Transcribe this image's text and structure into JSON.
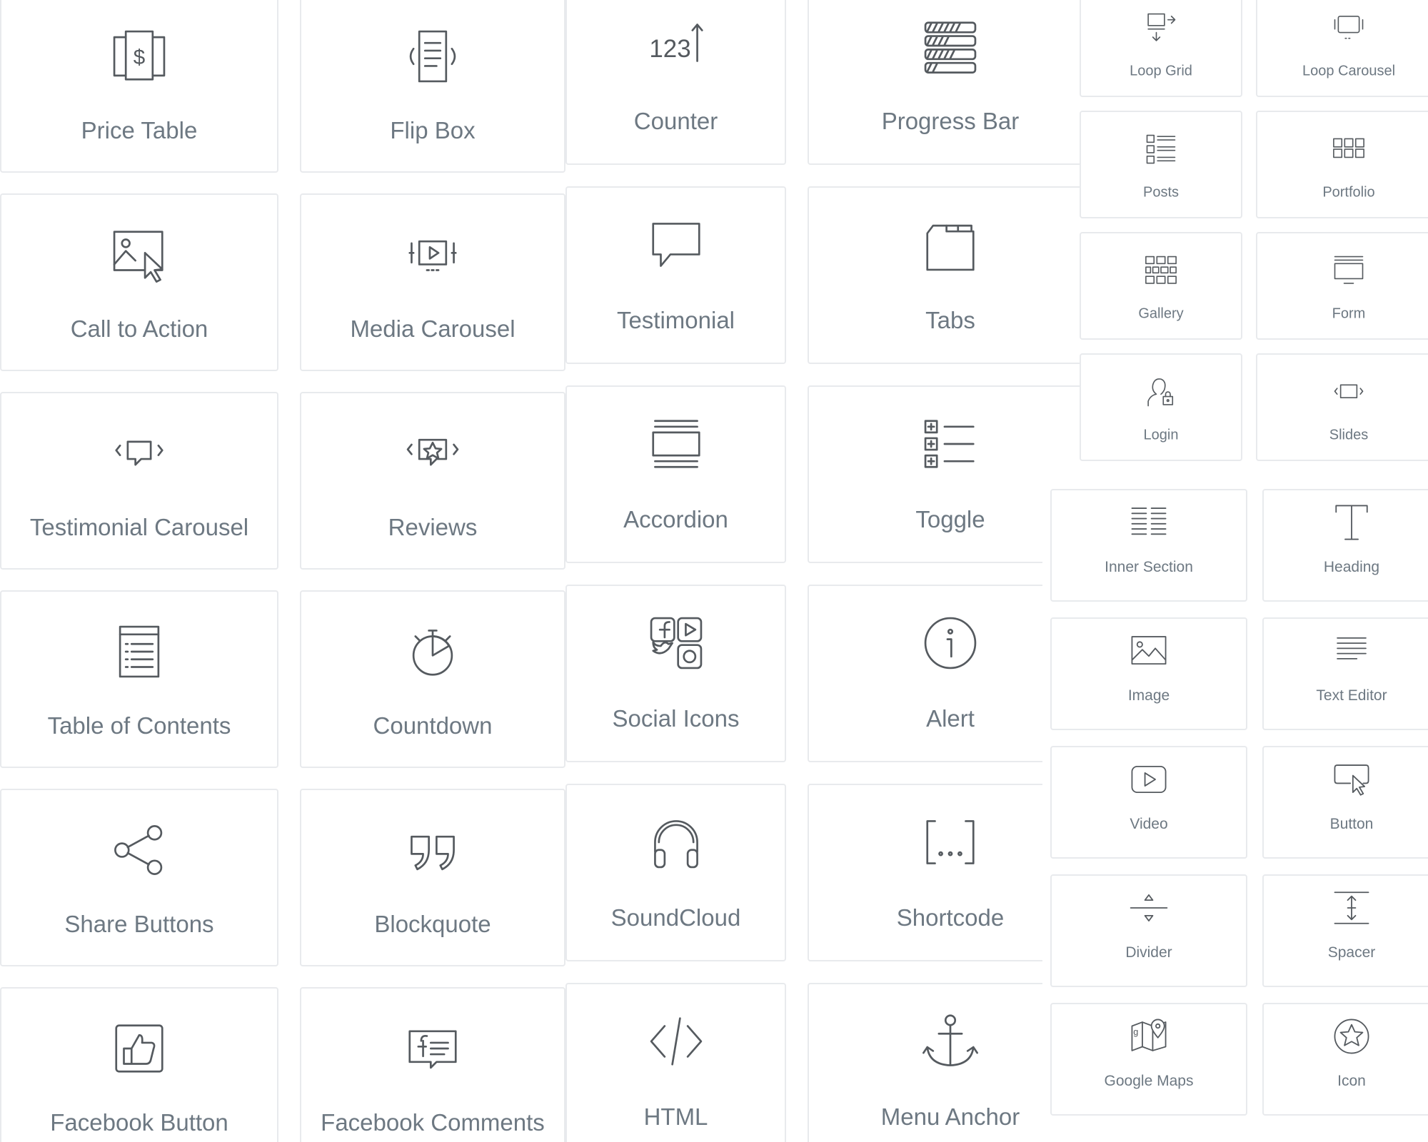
{
  "colors": {
    "text": "#6d7882",
    "icon": "#555a5f",
    "border": "#e8eaed",
    "background": "#ffffff"
  },
  "panels": [
    {
      "id": "pro-widgets-a",
      "widgets": [
        {
          "label": "Price Table",
          "icon": "price-table-icon"
        },
        {
          "label": "Flip Box",
          "icon": "flip-box-icon"
        },
        {
          "label": "Call to Action",
          "icon": "call-to-action-icon"
        },
        {
          "label": "Media Carousel",
          "icon": "media-carousel-icon"
        },
        {
          "label": "Testimonial Carousel",
          "icon": "testimonial-carousel-icon"
        },
        {
          "label": "Reviews",
          "icon": "reviews-icon"
        },
        {
          "label": "Table of Contents",
          "icon": "table-of-contents-icon"
        },
        {
          "label": "Countdown",
          "icon": "countdown-icon"
        },
        {
          "label": "Share Buttons",
          "icon": "share-icon"
        },
        {
          "label": "Blockquote",
          "icon": "blockquote-icon"
        },
        {
          "label": "Facebook Button",
          "icon": "facebook-like-icon"
        },
        {
          "label": "Facebook Comments",
          "icon": "facebook-comments-icon"
        }
      ]
    },
    {
      "id": "general-widgets",
      "widgets": [
        {
          "label": "Counter",
          "icon": "counter-icon"
        },
        {
          "label": "Progress Bar",
          "icon": "progress-bar-icon"
        },
        {
          "label": "Testimonial",
          "icon": "testimonial-icon"
        },
        {
          "label": "Tabs",
          "icon": "tabs-icon"
        },
        {
          "label": "Accordion",
          "icon": "accordion-icon"
        },
        {
          "label": "Toggle",
          "icon": "toggle-icon"
        },
        {
          "label": "Social Icons",
          "icon": "social-icons-icon"
        },
        {
          "label": "Alert",
          "icon": "alert-icon"
        },
        {
          "label": "SoundCloud",
          "icon": "headphones-icon"
        },
        {
          "label": "Shortcode",
          "icon": "shortcode-icon"
        },
        {
          "label": "HTML",
          "icon": "code-icon"
        },
        {
          "label": "Menu Anchor",
          "icon": "anchor-icon"
        }
      ]
    },
    {
      "id": "pro-widgets-b",
      "widgets": [
        {
          "label": "Loop Grid",
          "icon": "loop-grid-icon"
        },
        {
          "label": "Loop Carousel",
          "icon": "loop-carousel-icon"
        },
        {
          "label": "Posts",
          "icon": "posts-icon"
        },
        {
          "label": "Portfolio",
          "icon": "portfolio-icon"
        },
        {
          "label": "Gallery",
          "icon": "gallery-icon"
        },
        {
          "label": "Form",
          "icon": "form-icon"
        },
        {
          "label": "Login",
          "icon": "login-icon"
        },
        {
          "label": "Slides",
          "icon": "slides-icon"
        },
        {
          "label": "",
          "icon": ""
        },
        {
          "label": "",
          "icon": ""
        }
      ]
    },
    {
      "id": "basic-widgets",
      "widgets": [
        {
          "label": "Inner Section",
          "icon": "inner-section-icon"
        },
        {
          "label": "Heading",
          "icon": "heading-icon"
        },
        {
          "label": "Image",
          "icon": "image-icon"
        },
        {
          "label": "Text Editor",
          "icon": "text-editor-icon"
        },
        {
          "label": "Video",
          "icon": "video-icon"
        },
        {
          "label": "Button",
          "icon": "button-icon"
        },
        {
          "label": "Divider",
          "icon": "divider-icon"
        },
        {
          "label": "Spacer",
          "icon": "spacer-icon"
        },
        {
          "label": "Google Maps",
          "icon": "google-maps-icon"
        },
        {
          "label": "Icon",
          "icon": "star-icon"
        }
      ]
    }
  ]
}
